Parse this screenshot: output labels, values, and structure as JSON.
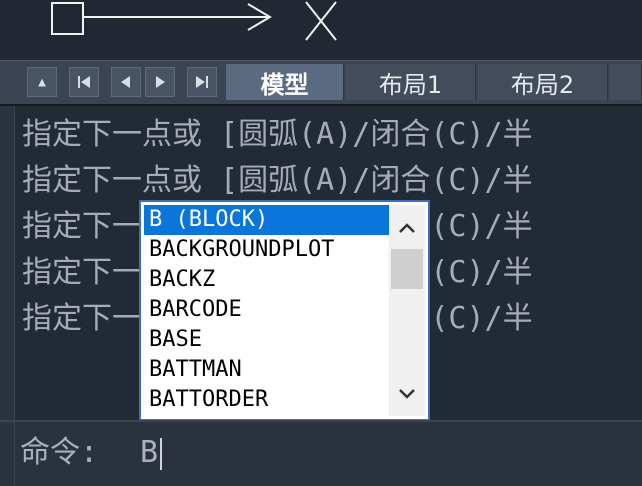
{
  "tabs": {
    "model": "模型",
    "layout1": "布局1",
    "layout2": "布局2"
  },
  "nav": {
    "up": "▲",
    "first": "⏮",
    "prev": "◀",
    "next": "▶",
    "last": "⏭"
  },
  "history": [
    "指定下一点或 [圆弧(A)/闭合(C)/半",
    "指定下一点或 [圆弧(A)/闭合(C)/半",
    "指定下一点或 [圆弧(A)/闭合(C)/半",
    "指定下一点或 [圆弧(A)/闭合(C)/半",
    "指定下一点或 [圆弧(A)/闭合(C)/半"
  ],
  "autocomplete": {
    "items": [
      "B (BLOCK)",
      "BACKGROUNDPLOT",
      "BACKZ",
      "BARCODE",
      "BASE",
      "BATTMAN",
      "BATTORDER"
    ],
    "selected_index": 0
  },
  "command": {
    "prompt": "命令:",
    "input": "B"
  },
  "colors": {
    "background": "#212833",
    "selection": "#0a76dc",
    "popup_border": "#3b6fb8"
  }
}
